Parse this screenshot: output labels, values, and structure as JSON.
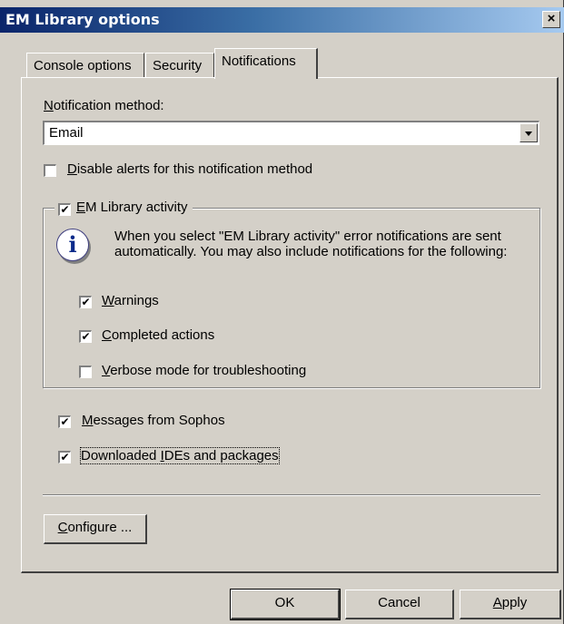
{
  "window": {
    "title": "EM Library options",
    "close_glyph": "×"
  },
  "tabs": [
    {
      "label": "Console options",
      "active": false
    },
    {
      "label": "Security",
      "active": false
    },
    {
      "label": "Notifications",
      "active": true
    }
  ],
  "notification_method": {
    "label_mnemonic": "N",
    "label_rest": "otification method:",
    "selected": "Email"
  },
  "disable_alerts": {
    "mnemonic": "D",
    "rest": "isable alerts for this notification method",
    "checked": false
  },
  "em_library_activity": {
    "mnemonic": "E",
    "rest": "M Library activity",
    "checked": true,
    "info_text": "When you select \"EM Library activity\" error notifications are sent automatically. You may also include notifications for the following:",
    "info_icon": "info-icon",
    "options": [
      {
        "mnemonic": "W",
        "rest": "arnings",
        "checked": true
      },
      {
        "mnemonic": "C",
        "rest": "ompleted actions",
        "checked": true
      },
      {
        "mnemonic": "V",
        "rest": "erbose mode for troubleshooting",
        "checked": false
      }
    ]
  },
  "messages_from_sophos": {
    "mnemonic": "M",
    "rest": "essages from Sophos",
    "checked": true
  },
  "downloaded_ides": {
    "pre": "Downloaded ",
    "mnemonic": "I",
    "rest": "DEs and packages",
    "checked": true
  },
  "configure_button": {
    "mnemonic": "C",
    "rest": "onfigure ..."
  },
  "footer": {
    "ok": "OK",
    "cancel": "Cancel",
    "apply_mnemonic": "A",
    "apply_rest": "pply"
  },
  "check_glyph": "✔"
}
